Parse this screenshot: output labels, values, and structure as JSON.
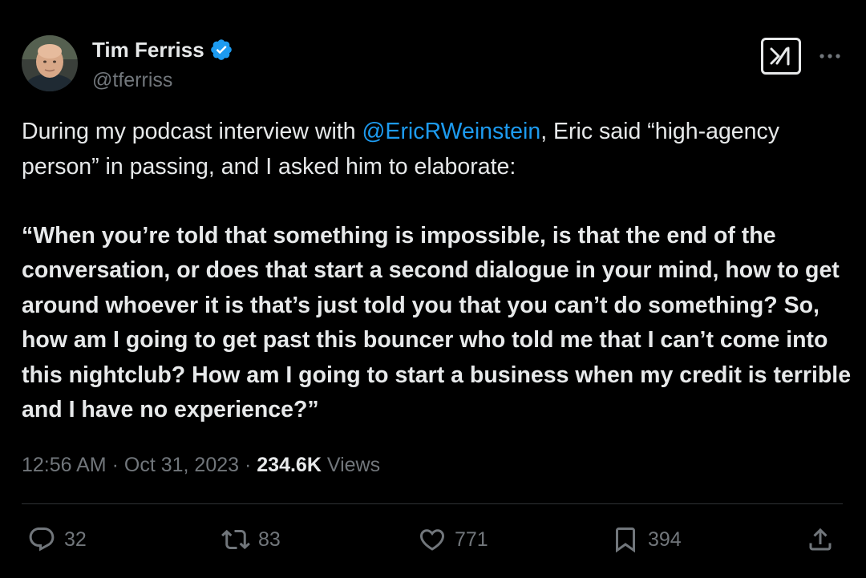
{
  "author": {
    "display_name": "Tim Ferriss",
    "handle": "@tferriss",
    "verified": true,
    "verified_badge_color": "#1d9bf0"
  },
  "tweet": {
    "text_before_mention": "During my podcast interview with ",
    "mention": "@EricRWeinstein",
    "text_after_mention": ", Eric said “high-agency person” in passing, and I asked him to elaborate:",
    "quote": "“When you’re told that something is impossible, is that the end of the conversation, or does that start a second dialogue in your mind, how to get around whoever it is that’s just told you that you can’t do something? So, how am I going to get past this bouncer who told me that I can’t come into this nightclub? How am I going to start a business when my credit is terrible and I have no experience?”"
  },
  "meta": {
    "time": "12:56 AM",
    "separator": "·",
    "date": "Oct 31, 2023",
    "views_count": "234.6K",
    "views_label": "Views"
  },
  "actions": {
    "replies": "32",
    "reposts": "83",
    "likes": "771",
    "bookmarks": "394"
  },
  "icons": {
    "top_right_logo": "xai-grok-logo-icon",
    "more": "more-dots-icon",
    "reply": "reply-bubble-icon",
    "repost": "repost-arrows-icon",
    "like": "heart-icon",
    "bookmark": "bookmark-icon",
    "share": "share-upload-icon"
  },
  "colors": {
    "background": "#000000",
    "text": "#e7e9ea",
    "muted": "#71767b",
    "link": "#1d9bf0",
    "divider": "#2f3336"
  }
}
